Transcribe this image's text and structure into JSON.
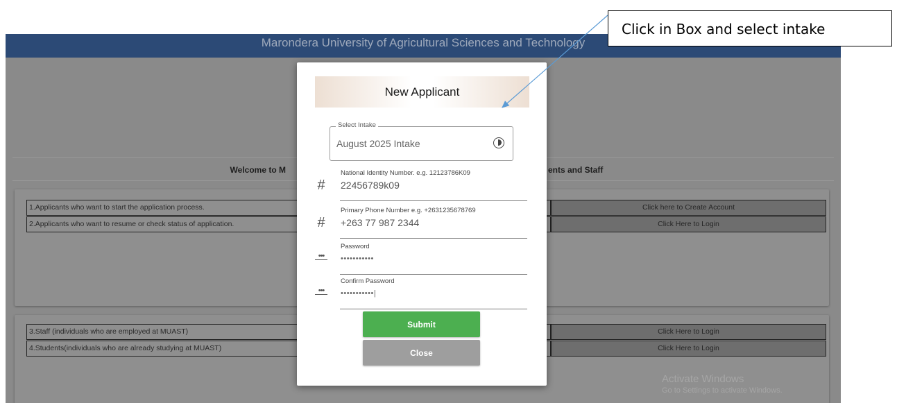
{
  "banner": {
    "title": "Marondera University of Agricultural Sciences and Technology"
  },
  "welcome": {
    "left": "Welcome to M",
    "right": "ents and Staff"
  },
  "rows_applicants": [
    {
      "label": "1.Applicants who want to start the application process.",
      "button": "Click here to Create Account"
    },
    {
      "label": "2.Applicants who want to resume or check status of application.",
      "button": "Click Here to Login"
    }
  ],
  "rows_staff": [
    {
      "label": "3.Staff (individuals who are employed at MUAST)",
      "button": "Click Here to Login"
    },
    {
      "label": "4.Students(individuals who are already studying at MUAST)",
      "button": "Click Here to Login"
    }
  ],
  "modal": {
    "title": "New Applicant",
    "intake": {
      "legend": "Select Intake",
      "value": "August 2025 Intake",
      "icon": "clock-icon"
    },
    "fields": [
      {
        "label": "National Identity Number. e.g. 12123786K09",
        "value": "22456789k09",
        "icon": "hash-icon"
      },
      {
        "label": "Primary Phone Number e.g. +2631235678769",
        "value": "+263 77 987 2344",
        "icon": "hash-icon"
      },
      {
        "label": "Password",
        "value": "•••••••••••",
        "icon": "password-dots-icon"
      },
      {
        "label": "Confirm Password",
        "value": "•••••••••••|",
        "icon": "password-dots-icon"
      }
    ],
    "submit_label": "Submit",
    "close_label": "Close"
  },
  "watermark": {
    "line1": "Activate Windows",
    "line2": "Go to Settings to activate Windows."
  },
  "callout": {
    "text": "Click in Box and select intake"
  },
  "colors": {
    "banner": "#2c4a76",
    "overlay": "#8a8a8a",
    "submit": "#4caf50",
    "close": "#9e9e9e",
    "arrow": "#5b9bd5"
  }
}
